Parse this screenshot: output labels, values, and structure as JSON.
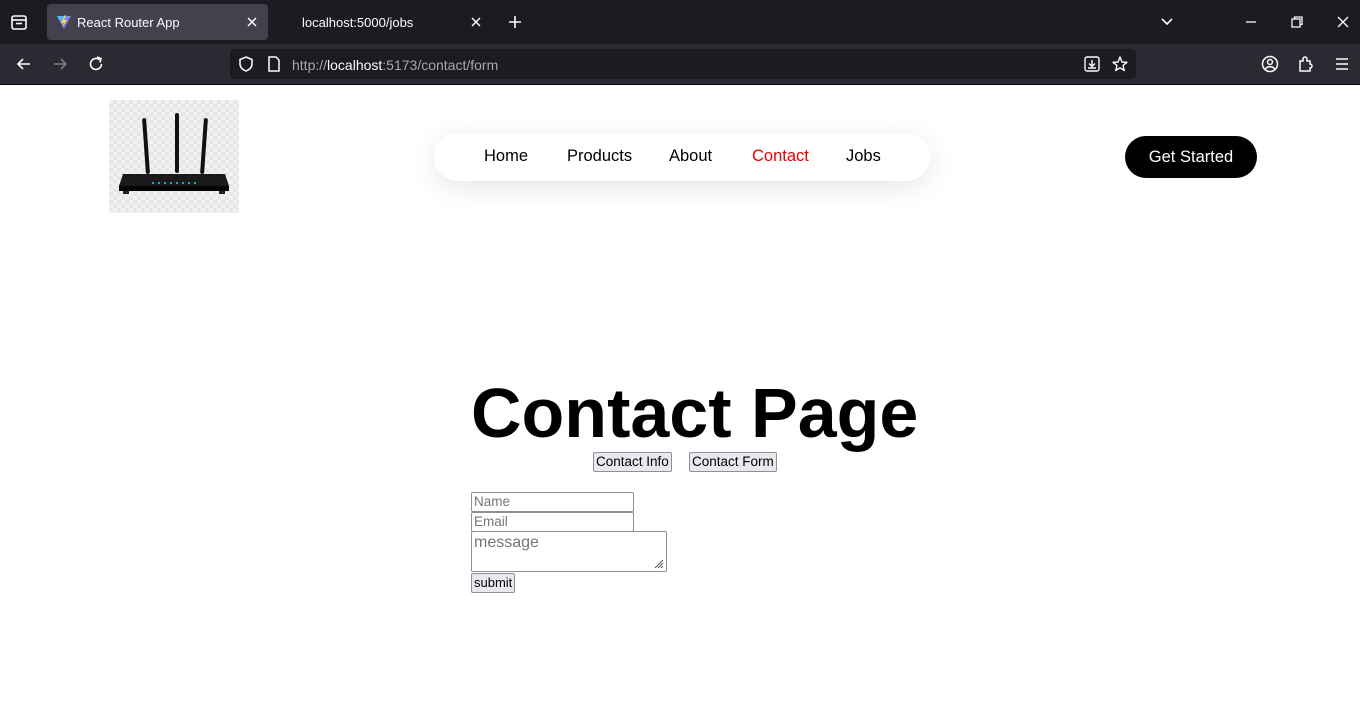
{
  "browser": {
    "tabs": [
      {
        "title": "React Router App",
        "active": true
      },
      {
        "title": "localhost:5000/jobs",
        "active": false
      }
    ],
    "url": {
      "prefix": "http://",
      "host": "localhost",
      "rest": ":5173/contact/form"
    }
  },
  "site": {
    "nav": [
      {
        "label": "Home",
        "active": false
      },
      {
        "label": "Products",
        "active": false
      },
      {
        "label": "About",
        "active": false
      },
      {
        "label": "Contact",
        "active": true
      },
      {
        "label": "Jobs",
        "active": false
      }
    ],
    "active_color": "#e60000",
    "cta_label": "Get Started"
  },
  "contact": {
    "heading": "Contact Page",
    "info_button": "Contact Info",
    "form_button": "Contact Form",
    "name_placeholder": "Name",
    "email_placeholder": "Email",
    "message_placeholder": "message",
    "submit_label": "submit"
  }
}
